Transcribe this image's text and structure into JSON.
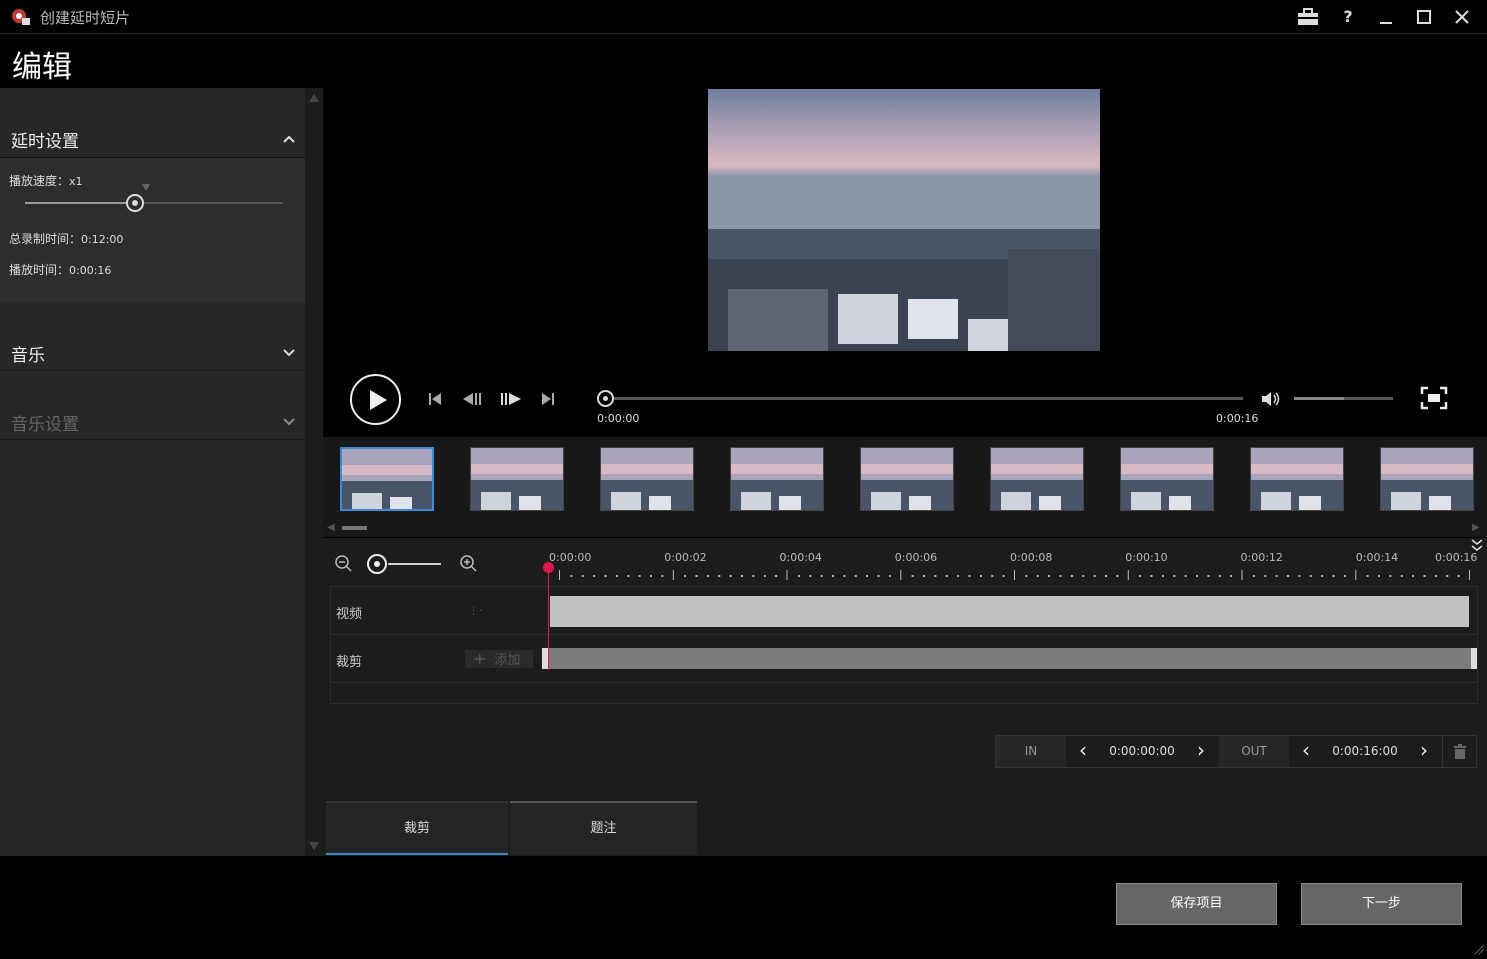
{
  "window": {
    "title": "创建延时短片"
  },
  "page": {
    "title": "编辑"
  },
  "sidebar": {
    "section1": {
      "title": "延时设置"
    },
    "speed_label": "播放速度：",
    "speed_value": "x1",
    "total_record_label": "总录制时间：",
    "total_record_value": "0:12:00",
    "play_time_label": "播放时间：",
    "play_time_value": "0:00:16",
    "section2": {
      "title": "音乐"
    },
    "section3": {
      "title": "音乐设置"
    }
  },
  "player": {
    "current_time": "0:00:00",
    "end_time": "0:00:16",
    "progress": 0,
    "volume": 0.5
  },
  "timeline": {
    "ticks": [
      "0:00:00",
      "0:00:02",
      "0:00:04",
      "0:00:06",
      "0:00:08",
      "0:00:10",
      "0:00:12",
      "0:00:14",
      "0:00:16"
    ],
    "track_video": "视频",
    "track_clip": "裁剪",
    "add_label": "添加",
    "in_label": "IN",
    "in_value": "0:00:00:00",
    "out_label": "OUT",
    "out_value": "0:00:16:00"
  },
  "tabs": [
    "裁剪",
    "题注"
  ],
  "footer": {
    "save": "保存项目",
    "next": "下一步"
  }
}
